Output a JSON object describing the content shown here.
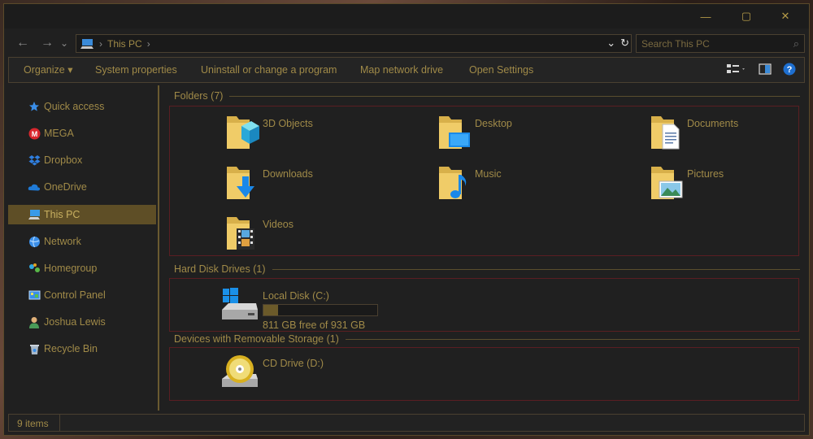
{
  "window": {
    "minimize_glyph": "—",
    "maximize_glyph": "▢",
    "close_glyph": "✕"
  },
  "nav": {
    "back_glyph": "←",
    "forward_glyph": "→",
    "recent_glyph": "⌄",
    "up_glyph": "↑"
  },
  "address": {
    "location": "This PC",
    "dropdown_glyph": "⌄",
    "refresh_glyph": "↻"
  },
  "search": {
    "placeholder": "Search This PC"
  },
  "toolbar": {
    "organize": "Organize ▾",
    "system_properties": "System properties",
    "uninstall": "Uninstall or change a program",
    "map_drive": "Map network drive",
    "open_settings": "Open Settings",
    "help_glyph": "?"
  },
  "sidebar": {
    "items": [
      {
        "label": "Quick access",
        "icon": "star-icon"
      },
      {
        "label": "MEGA",
        "icon": "mega-icon"
      },
      {
        "label": "Dropbox",
        "icon": "dropbox-icon"
      },
      {
        "label": "OneDrive",
        "icon": "onedrive-icon"
      },
      {
        "label": "This PC",
        "icon": "pc-icon",
        "selected": true
      },
      {
        "label": "Network",
        "icon": "network-icon"
      },
      {
        "label": "Homegroup",
        "icon": "homegroup-icon"
      },
      {
        "label": "Control Panel",
        "icon": "control-panel-icon"
      },
      {
        "label": "Joshua Lewis",
        "icon": "user-icon"
      },
      {
        "label": "Recycle Bin",
        "icon": "recycle-bin-icon"
      }
    ]
  },
  "groups": {
    "folders": {
      "title": "Folders (7)",
      "items": [
        {
          "label": "3D Objects",
          "icon": "3d-objects-folder-icon"
        },
        {
          "label": "Desktop",
          "icon": "desktop-folder-icon"
        },
        {
          "label": "Documents",
          "icon": "documents-folder-icon"
        },
        {
          "label": "Downloads",
          "icon": "downloads-folder-icon"
        },
        {
          "label": "Music",
          "icon": "music-folder-icon"
        },
        {
          "label": "Pictures",
          "icon": "pictures-folder-icon"
        },
        {
          "label": "Videos",
          "icon": "videos-folder-icon"
        }
      ]
    },
    "hdd": {
      "title": "Hard Disk Drives (1)",
      "drive": {
        "label": "Local Disk (C:)",
        "free_text": "811 GB free of 931 GB",
        "used_fraction": 0.129,
        "icon": "hard-disk-icon"
      }
    },
    "removable": {
      "title": "Devices with Removable Storage (1)",
      "drive": {
        "label": "CD Drive (D:)",
        "icon": "cd-drive-icon"
      }
    }
  },
  "status": {
    "item_count": "9 items"
  },
  "colors": {
    "accent": "#a08a48",
    "selection": "#5e4e26",
    "group_border": "#5a1e22",
    "window_bg": "#202020"
  }
}
